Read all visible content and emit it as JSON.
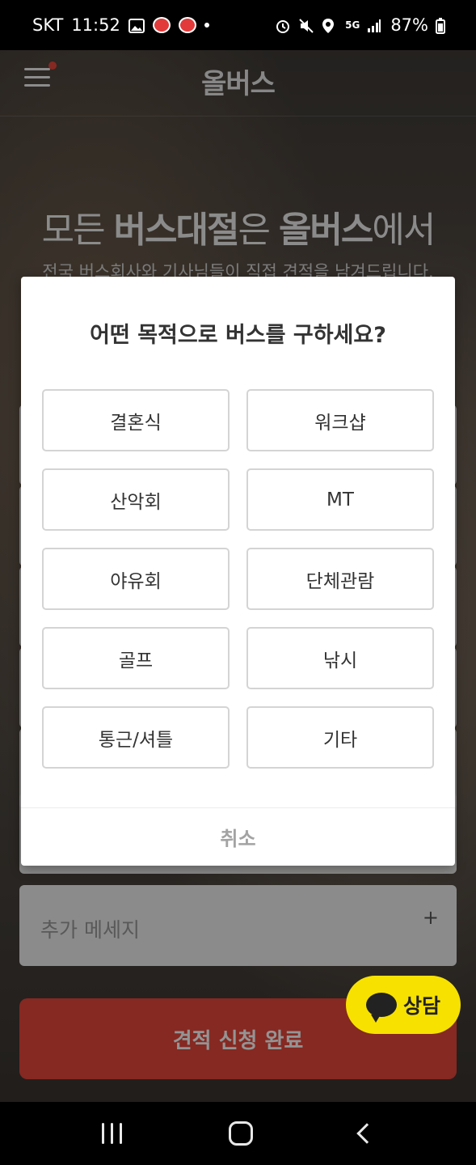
{
  "status_bar": {
    "carrier": "SKT",
    "time": "11:52",
    "network": "5G",
    "battery": "87%"
  },
  "app": {
    "logo": "올버스",
    "hero_title_parts": [
      "모든 ",
      "버스대절",
      "은 ",
      "올버스",
      "에서"
    ],
    "hero_subtitle": "전국 버스회사와 기사님들이 직접 견적을 남겨드립니다.",
    "extra_message_placeholder": "추가 메세지",
    "extra_message_plus": "+",
    "submit_label": "견적 신청 완료",
    "chat_label": "상담"
  },
  "dialog": {
    "title": "어떤 목적으로 버스를 구하세요?",
    "options": [
      "결혼식",
      "워크샵",
      "산악회",
      "MT",
      "야유회",
      "단체관람",
      "골프",
      "낚시",
      "통근/셔틀",
      "기타"
    ],
    "cancel_label": "취소"
  },
  "colors": {
    "accent": "#e5483c",
    "chat_yellow": "#f7e100"
  }
}
